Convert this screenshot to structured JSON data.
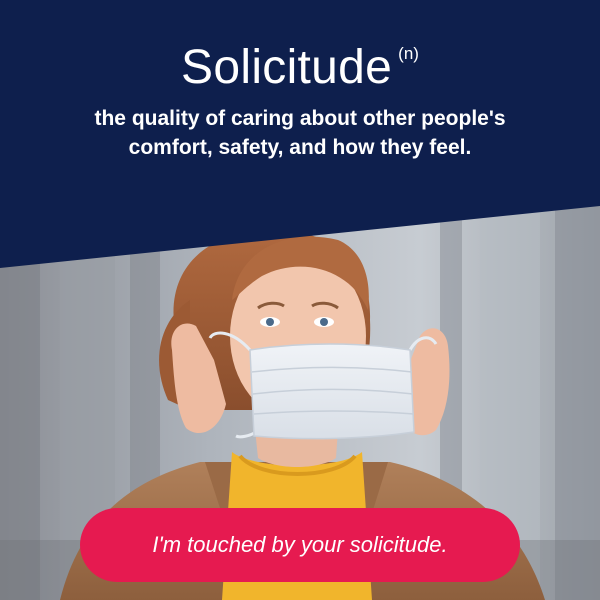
{
  "header": {
    "word": "Solicitude",
    "part_of_speech": "(n)",
    "definition_line1": "the quality of caring about other people's",
    "definition_line2": "comfort, safety, and how they feel."
  },
  "photo": {
    "subject": "person-putting-on-face-mask"
  },
  "caption": {
    "text": "I'm touched by your solicitude."
  },
  "colors": {
    "header_bg": "#0e1f4d",
    "pill_bg": "#e61a50",
    "text": "#ffffff",
    "coat": "#a8754f",
    "sweater": "#f1b52c",
    "mask": "#e6ebf1"
  }
}
